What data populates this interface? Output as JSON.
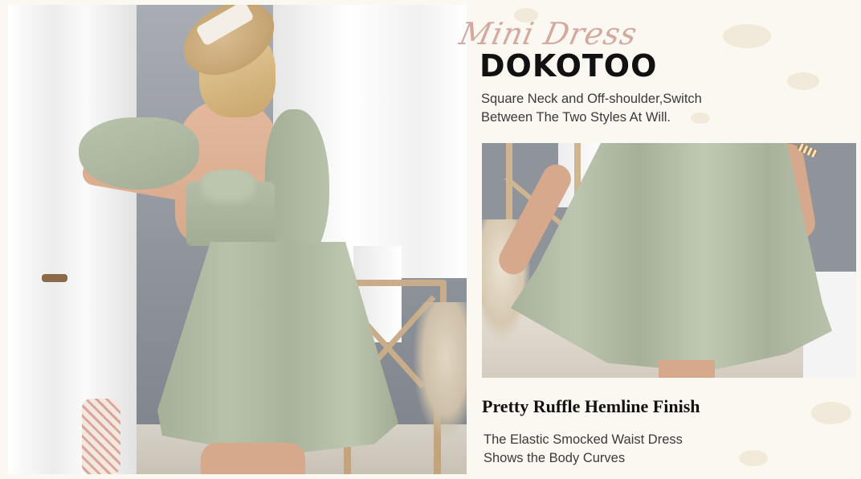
{
  "colors": {
    "background": "#fbf8f1",
    "script_accent": "#d4a99f",
    "brand_text": "#111111",
    "body_text": "#3a3a3a",
    "dress_sage": "#b0ba9f"
  },
  "header": {
    "script_title": "Mini Dress",
    "brand": "DOKOTOO"
  },
  "feature_1": {
    "lines": [
      "Square Neck and Off-shoulder,Switch",
      "Between The Two Styles At Will."
    ]
  },
  "feature_2": {
    "title": "Pretty Ruffle Hemline Finish",
    "lines": [
      "The Elastic Smocked Waist Dress",
      "Shows the Body Curves"
    ]
  }
}
